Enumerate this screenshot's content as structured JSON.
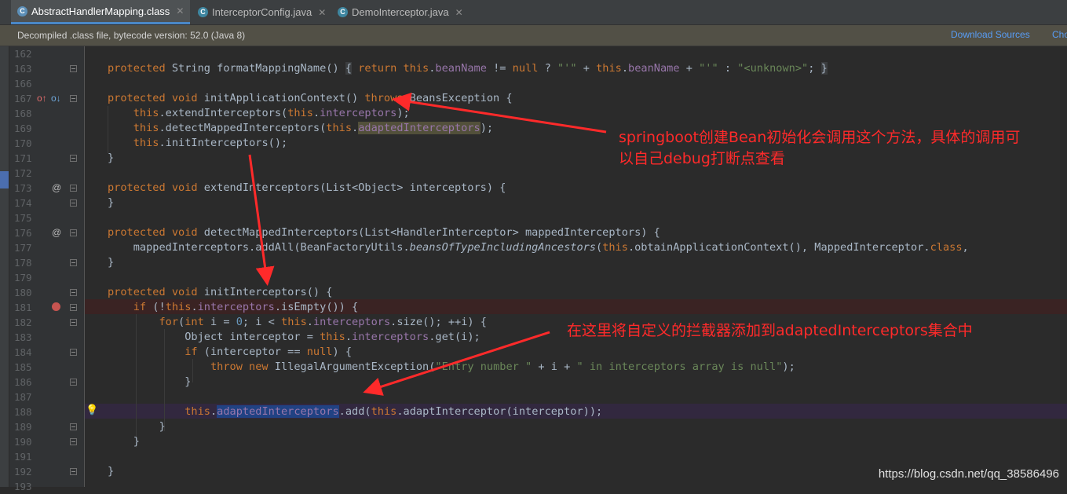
{
  "tabs": [
    {
      "label": "AbstractHandlerMapping.class",
      "icon": "class-file-icon",
      "active": true
    },
    {
      "label": "InterceptorConfig.java",
      "icon": "java-class-icon",
      "active": false
    },
    {
      "label": "DemoInterceptor.java",
      "icon": "java-class-icon",
      "active": false
    }
  ],
  "notice": {
    "text": "Decompiled .class file, bytecode version: 52.0 (Java 8)",
    "download_sources": "Download Sources",
    "choose_sources": "Cho"
  },
  "lines": [
    {
      "n": "162"
    },
    {
      "n": "163"
    },
    {
      "n": "166"
    },
    {
      "n": "167"
    },
    {
      "n": "168"
    },
    {
      "n": "169"
    },
    {
      "n": "170"
    },
    {
      "n": "171"
    },
    {
      "n": "172"
    },
    {
      "n": "173"
    },
    {
      "n": "174"
    },
    {
      "n": "175"
    },
    {
      "n": "176"
    },
    {
      "n": "177"
    },
    {
      "n": "178"
    },
    {
      "n": "179"
    },
    {
      "n": "180"
    },
    {
      "n": "181"
    },
    {
      "n": "182"
    },
    {
      "n": "183"
    },
    {
      "n": "184"
    },
    {
      "n": "185"
    },
    {
      "n": "186"
    },
    {
      "n": "187"
    },
    {
      "n": "188"
    },
    {
      "n": "189"
    },
    {
      "n": "190"
    },
    {
      "n": "191"
    },
    {
      "n": "192"
    },
    {
      "n": "193"
    }
  ],
  "annotations": {
    "first": "springboot创建Bean初始化会调用这个方法，具体的调用可",
    "first_line2": "以自己debug打断点查看",
    "second": "在这里将自定义的拦截器添加到adaptedInterceptors集合中"
  },
  "watermark": "https://blog.csdn.net/qq_38586496",
  "colors": {
    "keyword": "#cc7832",
    "field": "#9876aa",
    "string": "#6a8759",
    "annotation_red": "#ff2a2a",
    "background": "#2b2b2b"
  }
}
